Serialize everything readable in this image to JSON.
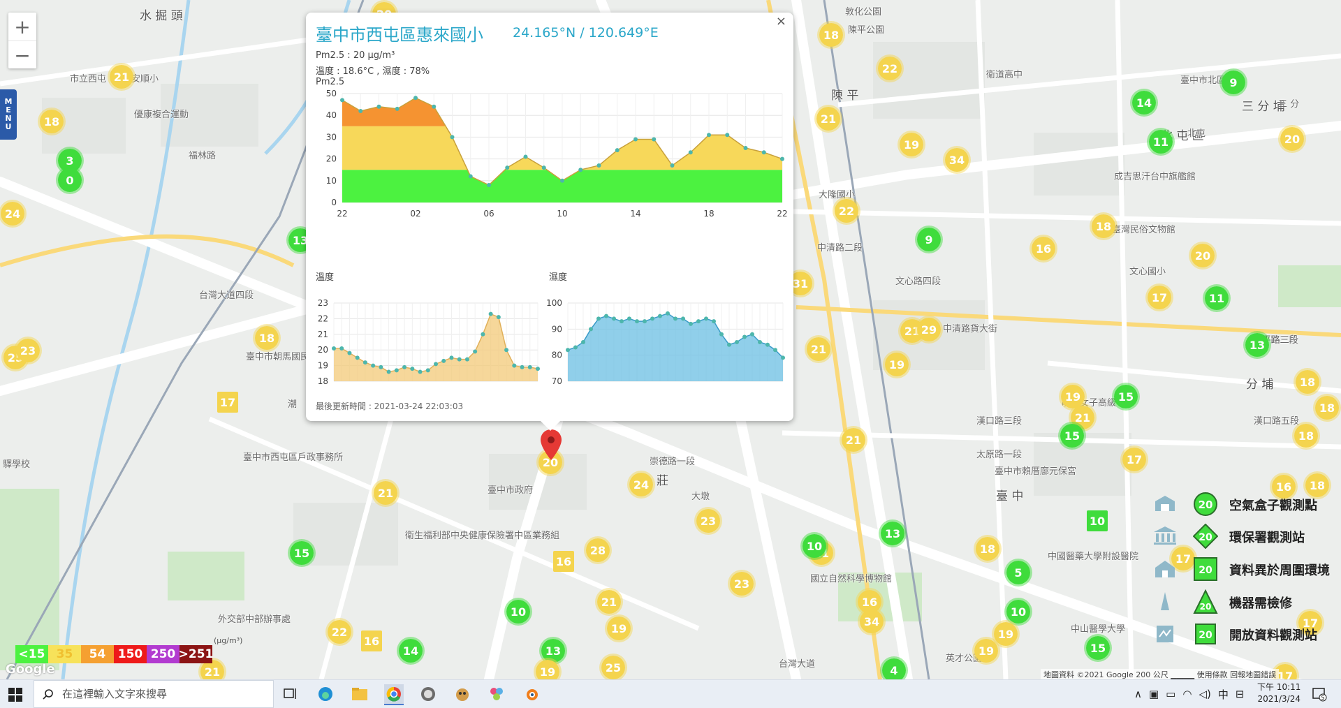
{
  "zoom": {
    "in_label": "+",
    "out_label": "−"
  },
  "menu": {
    "label": [
      "M",
      "E",
      "N",
      "U"
    ]
  },
  "popup": {
    "title": "臺中市西屯區惠來國小",
    "coord": "24.165°N / 120.649°E",
    "pm_line": "Pm2.5 : 20 μg/m³",
    "temp_hum_line": "溫度 : 18.6°C , 濕度 : 78%",
    "close_label": "×",
    "updated": "最後更新時間 : 2021-03-24 22:03:03",
    "charts_heading": "Pm2.5"
  },
  "chart_data": [
    {
      "type": "area",
      "title": "Pm2.5",
      "x": [
        "22",
        "",
        "02",
        "",
        "06",
        "",
        "10",
        "",
        "14",
        "",
        "18",
        "",
        "22"
      ],
      "x_ticks": [
        "22",
        "02",
        "06",
        "10",
        "14",
        "18",
        "22"
      ],
      "ylim": [
        0,
        50
      ],
      "y_ticks": [
        0,
        10,
        20,
        30,
        40,
        50
      ],
      "series": [
        {
          "values": [
            47,
            42,
            44,
            43,
            48,
            44,
            30,
            12,
            8,
            16,
            21,
            16,
            10,
            15,
            17,
            24,
            29,
            29,
            17,
            23,
            31,
            31,
            25,
            23,
            20
          ]
        }
      ],
      "bands": [
        {
          "max": 15,
          "color": "#4cf240"
        },
        {
          "max": 35,
          "color": "#f7d85a"
        },
        {
          "max": 54,
          "color": "#f59331"
        }
      ]
    },
    {
      "type": "area",
      "title": "溫度",
      "ylim": [
        18,
        23
      ],
      "y_ticks": [
        18,
        19,
        20,
        21,
        22,
        23
      ],
      "series": [
        {
          "values": [
            20.1,
            20.1,
            19.8,
            19.5,
            19.2,
            19.0,
            18.9,
            18.6,
            18.7,
            18.9,
            18.8,
            18.6,
            18.7,
            19.1,
            19.3,
            19.5,
            19.4,
            19.4,
            19.9,
            21.0,
            22.3,
            22.1,
            20.0,
            19.0,
            18.9,
            18.9,
            18.8
          ]
        }
      ],
      "color": "#f3c978"
    },
    {
      "type": "area",
      "title": "濕度",
      "ylim": [
        70,
        100
      ],
      "y_ticks": [
        70,
        80,
        90,
        100
      ],
      "series": [
        {
          "values": [
            82,
            83,
            85,
            90,
            94,
            95,
            94,
            93,
            94,
            93,
            93,
            94,
            95,
            96,
            94,
            94,
            92,
            93,
            94,
            93,
            88,
            84,
            85,
            87,
            88,
            85,
            84,
            82,
            79
          ]
        }
      ],
      "color": "#6bbfe3"
    }
  ],
  "legend": {
    "items": [
      {
        "label": "<15",
        "color": "#4cf240"
      },
      {
        "label": "35",
        "color": "#f7e25a"
      },
      {
        "label": "54",
        "color": "#f5a031"
      },
      {
        "label": "150",
        "color": "#ee1a1a"
      },
      {
        "label": "250",
        "color": "#b23bd0"
      },
      {
        "label": ">251",
        "color": "#8c1414"
      }
    ],
    "unit": "(μg/m³)"
  },
  "side_legend": [
    {
      "label": "空氣盒子觀測點",
      "value": "20",
      "shape": "circle"
    },
    {
      "label": "環保署觀測站",
      "value": "20",
      "shape": "diamond"
    },
    {
      "label": "資料異於周圍環境",
      "value": "20",
      "shape": "square"
    },
    {
      "label": "機器需檢修",
      "value": "20",
      "shape": "triangle"
    },
    {
      "label": "開放資料觀測站",
      "value": "20",
      "shape": "square"
    }
  ],
  "map": {
    "labels": [
      {
        "t": "水 掘 頭"
      },
      {
        "t": "市立西屯"
      },
      {
        "t": "安順小"
      },
      {
        "t": "優康複合運動"
      },
      {
        "t": "福林路"
      },
      {
        "t": "台灣大道四段"
      },
      {
        "t": "臺中市朝馬國民運動中心"
      },
      {
        "t": "臺中市西屯區戶政事務所"
      },
      {
        "t": "臺中市政府"
      },
      {
        "t": "衛生福利部中央健康保險署中區業務組"
      },
      {
        "t": "外交部中部辦事處"
      },
      {
        "t": "敦化公園"
      },
      {
        "t": "陳平公園"
      },
      {
        "t": "衛道高中"
      },
      {
        "t": "臺中市北區公所"
      },
      {
        "t": "三 分 埔"
      },
      {
        "t": "北 屯 區"
      },
      {
        "t": "成吉思汗台中旗艦館"
      },
      {
        "t": "臺灣民俗文物館"
      },
      {
        "t": "文心國小"
      },
      {
        "t": "文心路四段"
      },
      {
        "t": "中清路"
      },
      {
        "t": "大隆路"
      },
      {
        "t": "曉明女子高級中學"
      },
      {
        "t": "漢口路三段"
      },
      {
        "t": "太原路一段"
      },
      {
        "t": "臺中市賴厝廍元保宮"
      },
      {
        "t": "國立自然科學博物館"
      },
      {
        "t": "中國醫藥大學附設醫院"
      },
      {
        "t": "英才公園"
      },
      {
        "t": "分 埔"
      },
      {
        "t": "北平路三段"
      },
      {
        "t": "臺 中"
      },
      {
        "t": "中 清"
      },
      {
        "t": "潮"
      },
      {
        "t": "西屯"
      },
      {
        "t": "陳 平"
      },
      {
        "t": "大隆國小"
      },
      {
        "t": "漢口路五段"
      },
      {
        "t": "中山醫學大學"
      },
      {
        "t": "台灣大道"
      },
      {
        "t": "大墩"
      },
      {
        "t": "三 分"
      },
      {
        "t": "北屯"
      },
      {
        "t": "北平路三段"
      },
      {
        "t": "莊"
      },
      {
        "t": "驛學校"
      },
      {
        "t": "中清路二段"
      },
      {
        "t": "崇德路一段"
      },
      {
        "t": "中清路貨大街"
      }
    ],
    "markers": [
      {
        "v": "21"
      },
      {
        "v": "18"
      },
      {
        "v": "3"
      },
      {
        "v": "0"
      },
      {
        "v": "24"
      },
      {
        "v": "25"
      },
      {
        "v": "23"
      },
      {
        "v": "18"
      },
      {
        "v": "17"
      },
      {
        "v": "13"
      },
      {
        "v": "21"
      },
      {
        "v": "15"
      },
      {
        "v": "22"
      },
      {
        "v": "16"
      },
      {
        "v": "14"
      },
      {
        "v": "21"
      },
      {
        "v": "20"
      },
      {
        "v": "24"
      },
      {
        "v": "16"
      },
      {
        "v": "28"
      },
      {
        "v": "23"
      },
      {
        "v": "10"
      },
      {
        "v": "21"
      },
      {
        "v": "19"
      },
      {
        "v": "13"
      },
      {
        "v": "25"
      },
      {
        "v": "19"
      },
      {
        "v": "23"
      },
      {
        "v": "18"
      },
      {
        "v": "22"
      },
      {
        "v": "21"
      },
      {
        "v": "19"
      },
      {
        "v": "34"
      },
      {
        "v": "22"
      },
      {
        "v": "9"
      },
      {
        "v": "31"
      },
      {
        "v": "21"
      },
      {
        "v": "29"
      },
      {
        "v": "21"
      },
      {
        "v": "19"
      },
      {
        "v": "21"
      },
      {
        "v": "21"
      },
      {
        "v": "13"
      },
      {
        "v": "18"
      },
      {
        "v": "16"
      },
      {
        "v": "34"
      },
      {
        "v": "5"
      },
      {
        "v": "10"
      },
      {
        "v": "19"
      },
      {
        "v": "19"
      },
      {
        "v": "15"
      },
      {
        "v": "4"
      },
      {
        "v": "10"
      },
      {
        "v": "14"
      },
      {
        "v": "11"
      },
      {
        "v": "9"
      },
      {
        "v": "20"
      },
      {
        "v": "18"
      },
      {
        "v": "16"
      },
      {
        "v": "20"
      },
      {
        "v": "17"
      },
      {
        "v": "11"
      },
      {
        "v": "13"
      },
      {
        "v": "19"
      },
      {
        "v": "21"
      },
      {
        "v": "15"
      },
      {
        "v": "15"
      },
      {
        "v": "17"
      },
      {
        "v": "18"
      },
      {
        "v": "18"
      },
      {
        "v": "18"
      },
      {
        "v": "16"
      },
      {
        "v": "18"
      },
      {
        "v": "17"
      },
      {
        "v": "17"
      },
      {
        "v": "10"
      },
      {
        "v": "17"
      },
      {
        "v": "20"
      }
    ]
  },
  "attribution": "地圖資料 ©2021 Google   200 公尺 ▁▁▁▁   使用條款   回報地圖錯誤",
  "google_logo": "Google",
  "taskbar": {
    "search_placeholder": "在這裡輸入文字來搜尋",
    "time": "下午 10:11",
    "date": "2021/3/24",
    "ime": "中",
    "notifications": "5"
  }
}
